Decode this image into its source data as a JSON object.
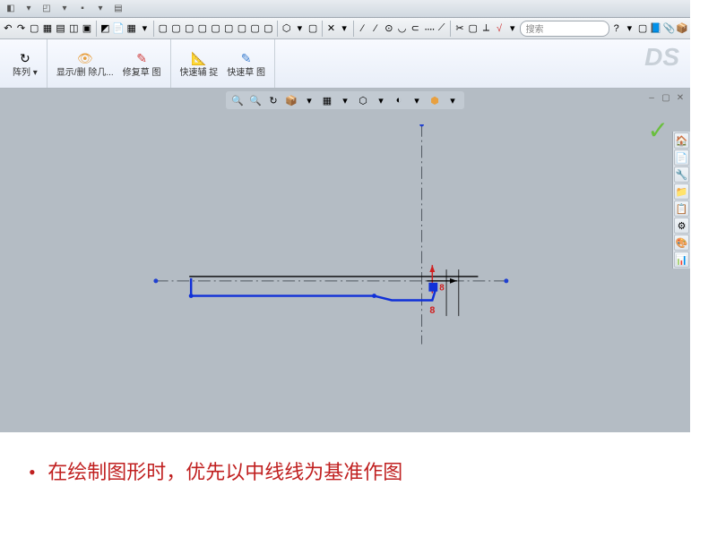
{
  "menu": {
    "items": [
      "◧",
      "▾",
      "◰",
      "▾",
      "▪",
      "▾",
      "▤"
    ]
  },
  "toolbar1": {
    "groups": [
      [
        "↶",
        "↷",
        "▢",
        "▦",
        "▤",
        "◫",
        "▣"
      ],
      [
        "◩",
        "📄",
        "▦",
        "▾"
      ],
      [
        "▢",
        "▢",
        "▢",
        "▢",
        "▢",
        "▢",
        "▢",
        "▢",
        "▢"
      ],
      [
        "⬡",
        "▾",
        "▢"
      ],
      [
        "✕",
        "▾"
      ],
      [
        "∕",
        "∕",
        "⊙",
        "◡",
        "⊂",
        "᠁",
        "⟋"
      ],
      [
        "✂",
        "▢",
        "⟂",
        "√",
        "▾"
      ],
      [
        "?",
        "▾",
        "▢",
        "📘",
        "📎",
        "📦"
      ]
    ]
  },
  "ribbon": {
    "buttons": [
      {
        "icon": "↻",
        "label": "阵列",
        "arrow": "▾"
      },
      {
        "icon": "👁",
        "label": "显示/删\n除几..."
      },
      {
        "icon": "✎",
        "label": "修复草\n图"
      },
      {
        "icon": "📐",
        "label": "快速辅\n捉"
      },
      {
        "icon": "✎",
        "label": "快速草\n图"
      }
    ],
    "logo": "DS"
  },
  "viewtools": [
    "🔍",
    "🔍",
    "↻",
    "📦",
    "▾",
    "▦",
    "▾",
    "⬡",
    "▾",
    "◐",
    "▾",
    "⬢",
    "▾"
  ],
  "search": {
    "placeholder": "搜索"
  },
  "wincontrols": [
    "‒",
    "▢",
    "✕"
  ],
  "sidepanel": [
    "🏠",
    "📄",
    "🔧",
    "📁",
    "📋",
    "⚙",
    "🎨",
    "📊"
  ],
  "dimension": "8",
  "caption": "在绘制图形时，优先以中线线为基准作图"
}
